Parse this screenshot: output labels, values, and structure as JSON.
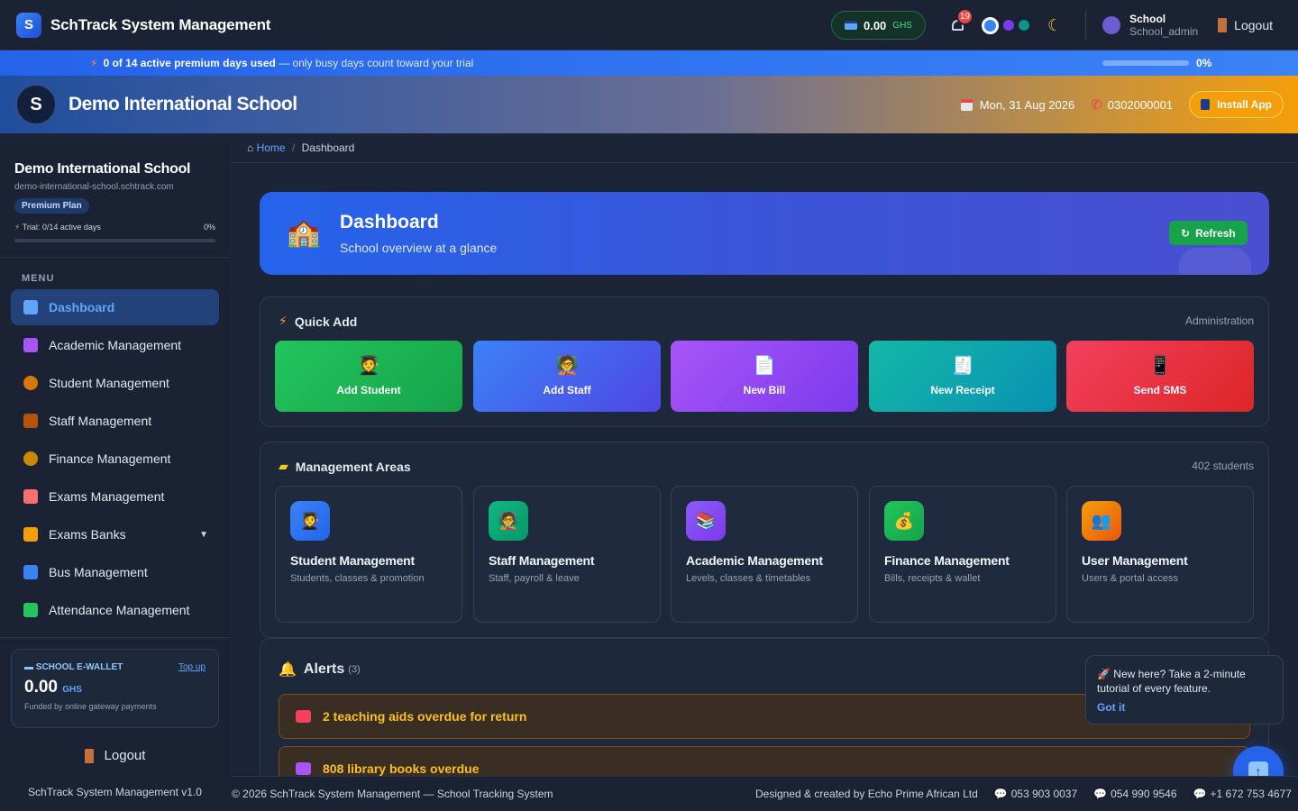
{
  "app": {
    "title": "SchTrack System Management",
    "logo_letter": "S"
  },
  "topbar": {
    "wallet_amount": "0.00",
    "wallet_currency": "GHS",
    "notifications_count": "19",
    "theme_colors": [
      "#3b82f6",
      "#7c3aed",
      "#0d9488"
    ],
    "user_name": "School",
    "user_role": "School_admin",
    "logout_label": "Logout"
  },
  "trial_strip": {
    "strong": "0 of 14 active premium days used",
    "rest": " — only busy days count toward your trial",
    "percent": "0%",
    "progress": 0
  },
  "school": {
    "name": "Demo International School",
    "date": "Mon, 31 Aug 2026",
    "phone": "0302000001",
    "install_label": "Install App"
  },
  "sidebar": {
    "school_name": "Demo International School",
    "domain": "demo-international-school.schtrack.com",
    "plan": "Premium Plan",
    "trial_text": "Trial: 0/14 active days",
    "trial_pct": "0%",
    "menu_label": "MENU",
    "items": [
      {
        "label": "Dashboard",
        "icon": "bar-chart-icon",
        "color": "#60a5fa"
      },
      {
        "label": "Academic Management",
        "icon": "books-icon",
        "color": "#a855f7"
      },
      {
        "label": "Student Management",
        "icon": "graduate-icon",
        "color": "#d97706"
      },
      {
        "label": "Staff Management",
        "icon": "teacher-icon",
        "color": "#b45309"
      },
      {
        "label": "Finance Management",
        "icon": "money-bag-icon",
        "color": "#ca8a04"
      },
      {
        "label": "Exams Management",
        "icon": "exam-paper-icon",
        "color": "#f87171"
      },
      {
        "label": "Exams Banks",
        "icon": "crown-icon",
        "color": "#f59e0b"
      },
      {
        "label": "Bus Management",
        "icon": "bus-icon",
        "color": "#3b82f6"
      },
      {
        "label": "Attendance Management",
        "icon": "check-box-icon",
        "color": "#22c55e"
      }
    ],
    "wallet": {
      "title": "SCHOOL E-WALLET",
      "topup": "Top up",
      "amount": "0.00",
      "currency": "GHS",
      "note": "Funded by online gateway payments"
    },
    "logout_label": "Logout",
    "version": "SchTrack System Management v1.0"
  },
  "breadcrumb": {
    "home": "Home",
    "sep": "/",
    "current": "Dashboard"
  },
  "hero": {
    "title": "Dashboard",
    "subtitle": "School overview at a glance",
    "refresh_label": "Refresh"
  },
  "quick_add": {
    "title": "Quick Add",
    "right": "Administration",
    "buttons": [
      {
        "label": "Add Student",
        "icon": "graduate-icon",
        "glyph": "🧑‍🎓"
      },
      {
        "label": "Add Staff",
        "icon": "teacher-icon",
        "glyph": "🧑‍🏫"
      },
      {
        "label": "New Bill",
        "icon": "document-icon",
        "glyph": "📄"
      },
      {
        "label": "New Receipt",
        "icon": "receipt-icon",
        "glyph": "🧾"
      },
      {
        "label": "Send SMS",
        "icon": "sms-icon",
        "glyph": "📱"
      }
    ]
  },
  "areas": {
    "title": "Management Areas",
    "right": "402 students",
    "cards": [
      {
        "title": "Student Management",
        "sub": "Students, classes & promotion",
        "glyph": "🧑‍🎓"
      },
      {
        "title": "Staff Management",
        "sub": "Staff, payroll & leave",
        "glyph": "🧑‍🏫"
      },
      {
        "title": "Academic Management",
        "sub": "Levels, classes & timetables",
        "glyph": "📚"
      },
      {
        "title": "Finance Management",
        "sub": "Bills, receipts & wallet",
        "glyph": "💰"
      },
      {
        "title": "User Management",
        "sub": "Users & portal access",
        "glyph": "👥"
      }
    ]
  },
  "alerts": {
    "title": "Alerts",
    "count": "(3)",
    "items": [
      {
        "text": "2 teaching aids overdue for return"
      },
      {
        "text": "808 library books overdue"
      }
    ]
  },
  "tour": {
    "text": "🚀 New here? Take a 2-minute tutorial of every feature.",
    "button": "Got it"
  },
  "footer": {
    "left": "© 2026 SchTrack System Management — School Tracking System",
    "credit": "Designed & created by Echo Prime African Ltd",
    "phones": [
      "053 903 0037",
      "054 990 9546",
      "+1 672 753 4677"
    ]
  }
}
